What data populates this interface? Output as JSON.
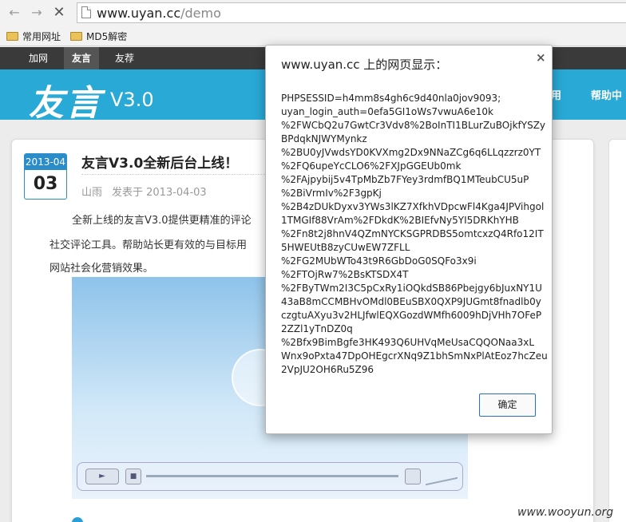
{
  "browser": {
    "url_host": "www.uyan.cc",
    "url_path": "/demo",
    "bookmarks": [
      {
        "label": "常用网址"
      },
      {
        "label": "MD5解密"
      }
    ]
  },
  "site": {
    "nav": [
      {
        "label": "加网"
      },
      {
        "label": "友言",
        "active": true
      },
      {
        "label": "友荐"
      }
    ],
    "logo": "友言",
    "version": "V3.0",
    "header_links": [
      "用",
      "帮助中"
    ],
    "post": {
      "date_month": "2013-04",
      "date_day": "03",
      "title": "友言V3.0全新后台上线！",
      "author": "山雨",
      "posted": "发表于 2013-04-03",
      "paragraphs": [
        "全新上线的友言V3.0提供更精准的评论",
        "社交评论工具。帮助站长更有效的与目标用",
        "网站社会化营销效果。"
      ]
    },
    "video": {
      "play_label": "►",
      "stop_label": "■"
    }
  },
  "dialog": {
    "title": "www.uyan.cc 上的网页显示：",
    "close": "×",
    "message": "PHPSESSID=h4mm8s4gh6c9d40nla0jov9093;\nuyan_login_auth=0efa5GI1oWs7vwuA6e10k\n%2FWCbQ2u7GwtCr3Vdv8%2BoInTI1BLurZuBOjkfYSZy\nBPdqkNJWYMynkz\n%2BU0yJVwdsYD0KVXmg2Dx9NNaZCg6q6LLqzzrz0YT\n%2FQ6upeYcCLO6%2FXJpGGEUb0mk\n%2FAjpybij5v4TpMbZb7FYey3rdmfBQ1MTeubCU5uP\n%2BiVrmIv%2F3gpKj\n%2B4zDUkDyxv3YWs3lKZ7XfkhVDpcwFl4Kga4JPVihgol\n1TMGIf88VrAm%2FDkdK%2BIEfvNy5YI5DRKhYHB\n%2Fn8t2j8hnV4QZmNYCKSGPRDBS5omtcxzQ4Rfo12IT\n5HWEUtB8zyCUwEW7ZFLL\n%2FG2MUbWTo43t9R6GbDoG0SQFo3x9i\n%2FTOjRw7%2BsKTSDX4T\n%2FByTWm2I3C5pCxRy1iOQkdSB86Pbejgy6bJuxNY1U\n43aB8mCCMBHvOMdl0BEuSBX0QXP9JUGmt8fnadlb0y\nczgtuAXyu3v2HLJfwlEQXGozdWMfh6009hDjVHh7OFeP\n2ZZl1yTnDZ0q\n%2Bfx9BimBgfe3HK493Q6UHVqMeUsaCQQONaa3xL\nWnx9oPxta47DpOHEgcrXNq9Z1bhSmNxPlAtEoz7hcZeu\n2VpJU2OH6Ru5Z96",
    "ok_label": "确定"
  },
  "watermark": "www.wooyun.org"
}
